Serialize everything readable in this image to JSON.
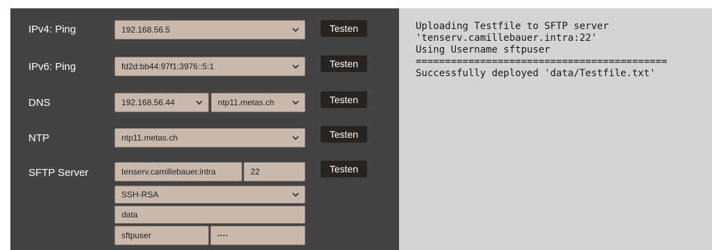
{
  "rows": {
    "ipv4": {
      "label": "IPv4: Ping",
      "value": "192.168.56.5",
      "button": "Testen"
    },
    "ipv6": {
      "label": "IPv6: Ping",
      "value": "fd2d:bb44:97f1:3976::5:1",
      "button": "Testen"
    },
    "dns": {
      "label": "DNS",
      "value1": "192.168.56.44",
      "value2": "ntp11.metas.ch",
      "button": "Testen"
    },
    "ntp": {
      "label": "NTP",
      "value": "ntp11.metas.ch",
      "button": "Testen"
    },
    "sftp": {
      "label": "SFTP Server",
      "host": "tenserv.camillebauer.intra",
      "port": "22",
      "auth": "SSH-RSA",
      "directory": "data",
      "username": "sftpuser",
      "password": "····",
      "button": "Testen"
    }
  },
  "log": {
    "lines": [
      "Uploading Testfile to SFTP server",
      "'tenserv.camillebauer.intra:22'",
      "Using Username sftpuser",
      "===========================================",
      "Successfully deployed 'data/Testfile.txt'"
    ]
  }
}
